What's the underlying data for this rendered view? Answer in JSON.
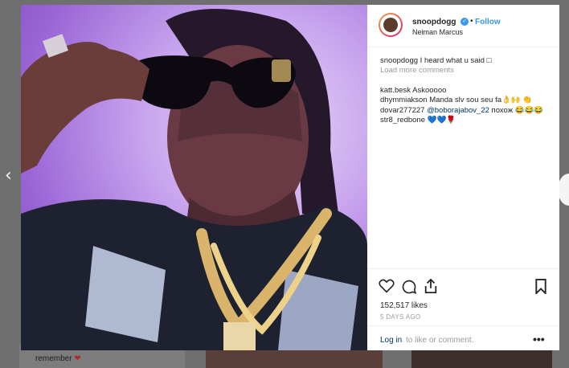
{
  "post": {
    "username": "snoopdogg",
    "follow_label": "Follow",
    "dot": "•",
    "location": "Neiman Marcus",
    "caption_user": "snoopdogg",
    "caption_text": "I heard what u said □",
    "load_more": "Load more comments",
    "comments": [
      {
        "user": "katt.besk",
        "text": "Askooooo"
      },
      {
        "user": "dhymmiakson",
        "text": "Manda slv sou seu fa👌🙌 👏"
      },
      {
        "user": "dovar277227",
        "mention": "@boborajabov_22",
        "text": "похож 😂😂😂"
      },
      {
        "user": "str8_redbone",
        "text": "💙💙🌹"
      }
    ],
    "likes": "152,517 likes",
    "time_ago": "5 DAYS AGO",
    "login_link": "Log in",
    "login_rest": "to like or comment.",
    "more": "•••"
  },
  "background": {
    "caption": "remember",
    "heart": "❤",
    "left_arrow": "‹"
  },
  "colors": {
    "link_blue": "#3897f0",
    "dark_link": "#003569",
    "text": "#262626",
    "muted": "#999999"
  },
  "icons": [
    "heart-icon",
    "comment-icon",
    "share-icon",
    "bookmark-icon",
    "verified-icon",
    "more-icon"
  ]
}
